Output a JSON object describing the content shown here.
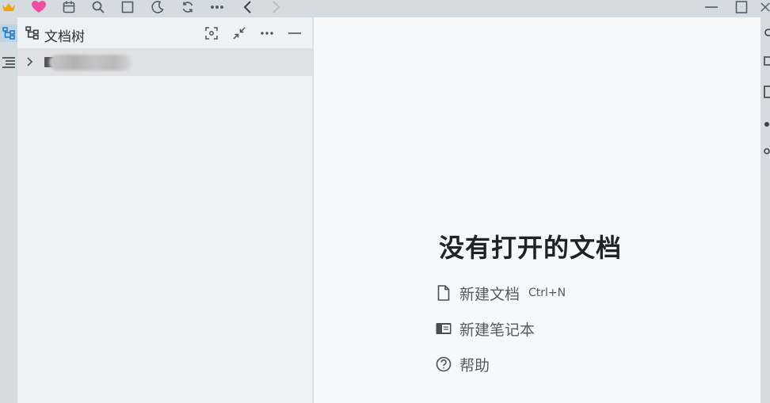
{
  "toolbar": {
    "icons": [
      "crown-icon",
      "heart-icon",
      "calendar-icon",
      "search-icon",
      "window-icon",
      "moon-icon",
      "sync-icon",
      "more-icon",
      "back-icon",
      "forward-icon"
    ],
    "colors": {
      "crown": "#f2a500",
      "heart": "#f04ca0",
      "disabled": "#b8bec4"
    }
  },
  "dock_left": {
    "icons": [
      "file-tree-icon",
      "outline-icon"
    ]
  },
  "file_tree": {
    "title": "文档树",
    "header_actions": [
      "focus-icon",
      "collapse-icon",
      "more-icon",
      "minimize-icon"
    ],
    "items": [
      {
        "label": "",
        "expanded": false
      }
    ]
  },
  "editor": {
    "empty_title": "没有打开的文档",
    "actions": {
      "new_doc": {
        "label": "新建文档",
        "shortcut": "Ctrl+N"
      },
      "new_notebook": {
        "label": "新建笔记本"
      },
      "help": {
        "label": "帮助"
      }
    }
  },
  "colors": {
    "chrome": "#d4dbe1",
    "panel": "#eff2f5",
    "editor_bg": "#f7f8fa",
    "selected_row": "#dfe1e4",
    "active_dock": "#bfd3e6"
  }
}
